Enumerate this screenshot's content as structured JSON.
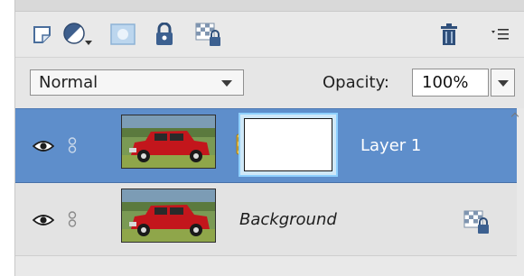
{
  "toolbar": {
    "icons": [
      {
        "name": "new-layer-icon"
      },
      {
        "name": "adjustment-layer-icon"
      },
      {
        "name": "add-mask-icon"
      },
      {
        "name": "lock-all-icon"
      },
      {
        "name": "lock-transparency-icon"
      },
      {
        "name": "trash-icon"
      },
      {
        "name": "panel-menu-icon"
      }
    ]
  },
  "blend": {
    "mode": "Normal",
    "opacity_label": "Opacity:",
    "opacity_value": "100%"
  },
  "layers": [
    {
      "name": "Layer 1",
      "selected": true,
      "has_mask": true,
      "visible": true
    },
    {
      "name": "Background",
      "selected": false,
      "locked": true,
      "visible": true
    }
  ],
  "colors": {
    "selected_row": "#5e8ecb",
    "panel_bg": "#e9e9e9",
    "mask_highlight": "#8fd0ff"
  }
}
